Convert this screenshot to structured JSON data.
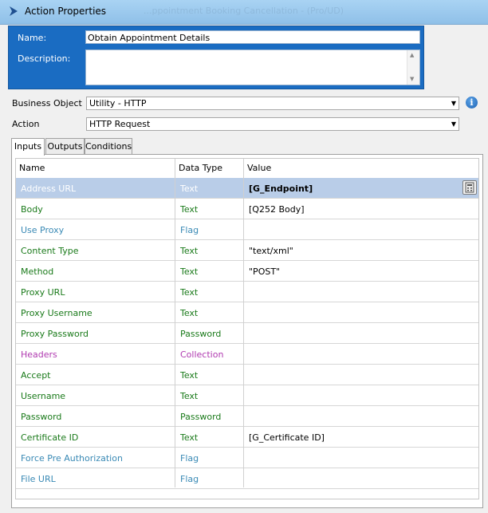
{
  "window": {
    "title": "Action Properties",
    "ghost_title": "...ppointment Booking Cancellation - (Pro/UD)"
  },
  "header": {
    "name_label": "Name:",
    "name_value": "Obtain Appointment Details",
    "description_label": "Description:",
    "description_value": ""
  },
  "business_object": {
    "label": "Business Object",
    "value": "Utility - HTTP",
    "info_icon": "info-icon"
  },
  "action": {
    "label": "Action",
    "value": "HTTP Request"
  },
  "tabs": [
    {
      "label": "Inputs",
      "active": true
    },
    {
      "label": "Outputs",
      "active": false
    },
    {
      "label": "Conditions",
      "active": false
    }
  ],
  "grid": {
    "columns": [
      "Name",
      "Data Type",
      "Value"
    ],
    "rows": [
      {
        "name": "Address URL",
        "type": "Text",
        "value": "[G_Endpoint]",
        "color": "#ffffff",
        "value_color": "#000000",
        "selected": true
      },
      {
        "name": "Body",
        "type": "Text",
        "value": "[Q252 Body]",
        "color": "#1a7a1a",
        "value_color": "#000000",
        "selected": false
      },
      {
        "name": "Use Proxy",
        "type": "Flag",
        "value": "",
        "color": "#3a8ab5",
        "value_color": "#000000",
        "selected": false
      },
      {
        "name": "Content Type",
        "type": "Text",
        "value": "\"text/xml\"",
        "color": "#1a7a1a",
        "value_color": "#000000",
        "selected": false
      },
      {
        "name": "Method",
        "type": "Text",
        "value": "\"POST\"",
        "color": "#1a7a1a",
        "value_color": "#000000",
        "selected": false
      },
      {
        "name": "Proxy URL",
        "type": "Text",
        "value": "",
        "color": "#1a7a1a",
        "value_color": "#000000",
        "selected": false
      },
      {
        "name": "Proxy Username",
        "type": "Text",
        "value": "",
        "color": "#1a7a1a",
        "value_color": "#000000",
        "selected": false
      },
      {
        "name": "Proxy Password",
        "type": "Password",
        "value": "",
        "color": "#1a7a1a",
        "value_color": "#000000",
        "selected": false
      },
      {
        "name": "Headers",
        "type": "Collection",
        "value": "",
        "color": "#b03ab0",
        "value_color": "#000000",
        "selected": false
      },
      {
        "name": "Accept",
        "type": "Text",
        "value": "",
        "color": "#1a7a1a",
        "value_color": "#000000",
        "selected": false
      },
      {
        "name": "Username",
        "type": "Text",
        "value": "",
        "color": "#1a7a1a",
        "value_color": "#000000",
        "selected": false
      },
      {
        "name": "Password",
        "type": "Password",
        "value": "",
        "color": "#1a7a1a",
        "value_color": "#000000",
        "selected": false
      },
      {
        "name": "Certificate ID",
        "type": "Text",
        "value": "[G_Certificate ID]",
        "color": "#1a7a1a",
        "value_color": "#000000",
        "selected": false
      },
      {
        "name": "Force Pre Authorization",
        "type": "Flag",
        "value": "",
        "color": "#3a8ab5",
        "value_color": "#000000",
        "selected": false
      },
      {
        "name": "File URL",
        "type": "Flag",
        "value": "",
        "color": "#3a8ab5",
        "value_color": "#000000",
        "selected": false
      }
    ]
  }
}
